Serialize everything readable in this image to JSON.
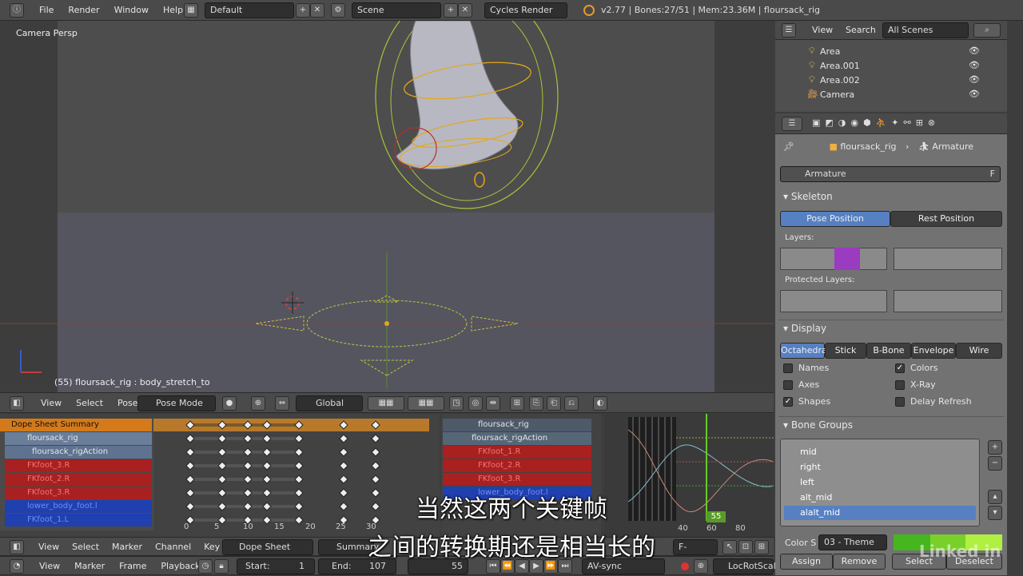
{
  "topbar": {
    "menus": [
      "File",
      "Render",
      "Window",
      "Help"
    ],
    "layout": "Default",
    "scene": "Scene",
    "engine": "Cycles Render",
    "info": "v2.77 | Bones:27/51 | Mem:23.36M | floursack_rig"
  },
  "viewport": {
    "label": "Camera Persp",
    "status": "(55) floursack_rig : body_stretch_to"
  },
  "vp_header": {
    "items": [
      "View",
      "Select",
      "Pose"
    ],
    "mode": "Pose Mode",
    "orientation": "Global"
  },
  "outliner": {
    "menus": [
      "View",
      "Search"
    ],
    "filter": "All Scenes",
    "items": [
      "Area",
      "Area.001",
      "Area.002",
      "Camera"
    ]
  },
  "props": {
    "breadcrumb_obj": "floursack_rig",
    "breadcrumb_data": "Armature",
    "datablock": "Armature",
    "fake": "F",
    "skeleton": "Skeleton",
    "pose_position": "Pose Position",
    "rest_position": "Rest Position",
    "layers": "Layers:",
    "protected_layers": "Protected Layers:",
    "display": "Display",
    "display_types": [
      "Octahedral",
      "Stick",
      "B-Bone",
      "Envelope",
      "Wire"
    ],
    "checks": [
      {
        "label": "Names",
        "on": false
      },
      {
        "label": "Colors",
        "on": true
      },
      {
        "label": "Axes",
        "on": false
      },
      {
        "label": "X-Ray",
        "on": false
      },
      {
        "label": "Shapes",
        "on": true
      },
      {
        "label": "Delay Refresh",
        "on": false
      }
    ],
    "bone_groups": "Bone Groups",
    "groups": [
      "mid",
      "right",
      "left",
      "alt_mid",
      "alalt_mid"
    ],
    "color_set_label": "Color S",
    "color_set": "03 - Theme ...",
    "assign": "Assign",
    "remove": "Remove",
    "select": "Select",
    "deselect": "Deselect"
  },
  "dopesheet": {
    "channels": [
      {
        "name": "Dope Sheet Summary",
        "kind": "summary"
      },
      {
        "name": "floursack_rig",
        "kind": "object"
      },
      {
        "name": "floursack_rigAction",
        "kind": "action"
      },
      {
        "name": "FKfoot_3.R",
        "kind": "red"
      },
      {
        "name": "FKfoot_2.R",
        "kind": "red"
      },
      {
        "name": "FKfoot_3.R",
        "kind": "red"
      },
      {
        "name": "lower_body_foot.l",
        "kind": "blue"
      },
      {
        "name": "FKfoot_1.L",
        "kind": "blue"
      }
    ],
    "ticks": [
      "0",
      "5",
      "10",
      "15",
      "20",
      "25",
      "30"
    ],
    "header": [
      "View",
      "Select",
      "Marker",
      "Channel",
      "Key"
    ],
    "mode": "Dope Sheet",
    "summary": "Summary"
  },
  "nla": {
    "rows": [
      {
        "name": "floursack_rig",
        "kind": "object"
      },
      {
        "name": "floursack_rigAction",
        "kind": "action"
      },
      {
        "name": "FKfoot_1.R",
        "kind": "red"
      },
      {
        "name": "FKfoot_2.R",
        "kind": "red"
      },
      {
        "name": "FKfoot_3.R",
        "kind": "red"
      },
      {
        "name": "lower_body_foot.l",
        "kind": "blue"
      }
    ]
  },
  "graph": {
    "ticks": [
      "40",
      "60",
      "80"
    ],
    "frame": "55",
    "mode": "F-Curve"
  },
  "timeline": {
    "menus": [
      "View",
      "Marker",
      "Frame",
      "Playback"
    ],
    "start_label": "Start:",
    "start": "1",
    "end_label": "End:",
    "end": "107",
    "current": "55",
    "sync": "AV-sync",
    "keying": "LocRotScal"
  },
  "subtitles": {
    "line1": "当然这两个关键帧",
    "line2": "之间的转换期还是相当长的"
  },
  "watermark": "Linked in"
}
